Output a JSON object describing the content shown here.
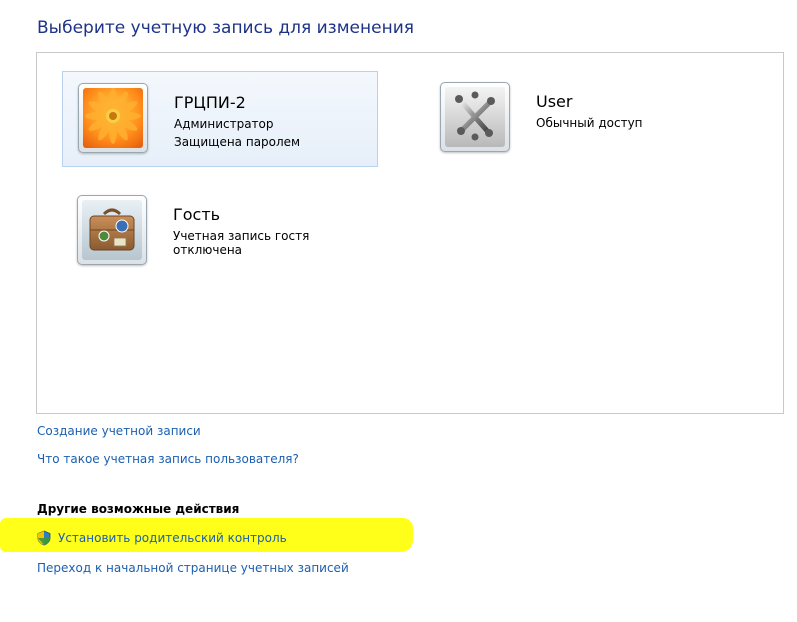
{
  "header": {
    "title": "Выберите учетную запись для изменения"
  },
  "accounts": [
    {
      "name": "ГРЦПИ-2",
      "line1": "Администратор",
      "line2": "Защищена паролем",
      "picture": "orange-flower-icon"
    },
    {
      "name": "User",
      "line1": "Обычный доступ",
      "picture": "jacks-icon"
    },
    {
      "name": "Гость",
      "line1": "Учетная запись гостя отключена",
      "picture": "suitcase-icon"
    }
  ],
  "links": {
    "create_account": "Создание учетной записи",
    "what_is_account": "Что такое учетная запись пользователя?"
  },
  "other_actions": {
    "heading": "Другие возможные действия",
    "parental_control": "Установить родительский контроль",
    "accounts_home": "Переход к начальной странице учетных записей"
  },
  "colors": {
    "title": "#1e3287",
    "link": "#1b5fb0",
    "highlight": "#ffff1a",
    "selected_tile": "#e6eff9"
  }
}
